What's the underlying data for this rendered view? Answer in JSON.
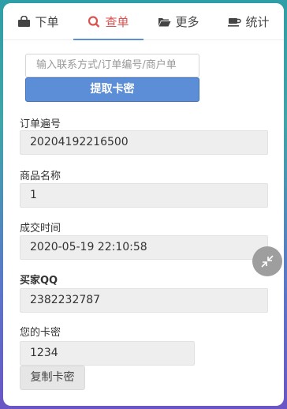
{
  "tabs": [
    {
      "label": "下单",
      "icon": "shopping-bag-icon"
    },
    {
      "label": "查单",
      "icon": "search-icon",
      "active": true
    },
    {
      "label": "更多",
      "icon": "folder-open-icon"
    },
    {
      "label": "统计",
      "icon": "coffee-cup-icon"
    }
  ],
  "search": {
    "placeholder": "输入联系方式/订单编号/商户单",
    "button_label": "提取卡密"
  },
  "fields": {
    "order_no": {
      "label": "订单遍号",
      "value": "20204192216500"
    },
    "product": {
      "label": "商品名称",
      "value": "1"
    },
    "time": {
      "label": "成交时间",
      "value": "2020-05-19 22:10:58"
    },
    "qq": {
      "label": "买家QQ",
      "value": "2382232787"
    },
    "card": {
      "label": "您的卡密",
      "value": "1234"
    }
  },
  "copy_button_label": "复制卡密",
  "colors": {
    "accent": "#5b8ed6",
    "active_tab": "#d9534f"
  },
  "float_button_icon": "collapse-arrows-icon"
}
